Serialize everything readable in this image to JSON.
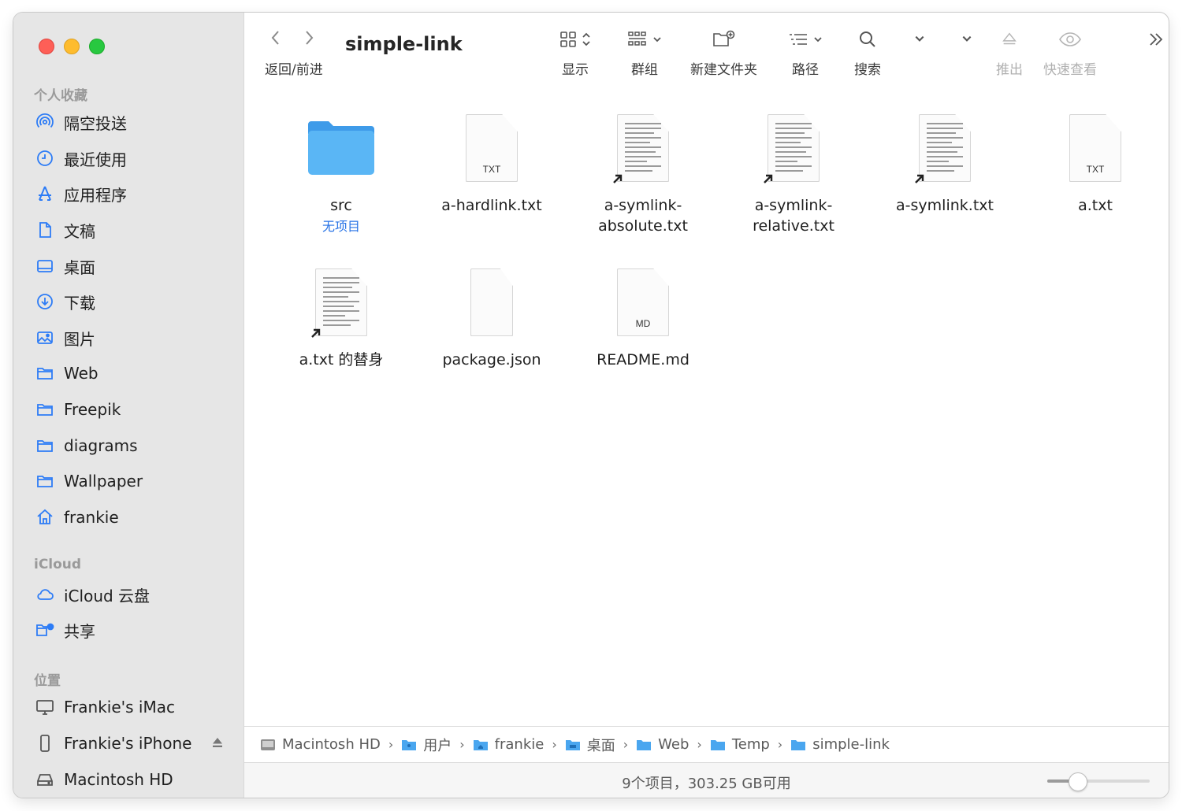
{
  "window": {
    "title": "simple-link"
  },
  "toolbar": {
    "nav_label": "返回/前进",
    "display_label": "显示",
    "group_label": "群组",
    "new_folder_label": "新建文件夹",
    "path_label": "路径",
    "search_label": "搜索",
    "eject_label": "推出",
    "quicklook_label": "快速查看"
  },
  "sidebar": {
    "favorites_title": "个人收藏",
    "favorites": [
      {
        "label": "隔空投送",
        "icon": "airdrop-icon"
      },
      {
        "label": "最近使用",
        "icon": "clock-icon"
      },
      {
        "label": "应用程序",
        "icon": "applications-icon"
      },
      {
        "label": "文稿",
        "icon": "document-icon"
      },
      {
        "label": "桌面",
        "icon": "desktop-icon"
      },
      {
        "label": "下载",
        "icon": "download-icon"
      },
      {
        "label": "图片",
        "icon": "photo-icon"
      },
      {
        "label": "Web",
        "icon": "folder-icon"
      },
      {
        "label": "Freepik",
        "icon": "folder-icon"
      },
      {
        "label": "diagrams",
        "icon": "folder-icon"
      },
      {
        "label": "Wallpaper",
        "icon": "folder-icon"
      },
      {
        "label": "frankie",
        "icon": "home-icon"
      }
    ],
    "icloud_title": "iCloud",
    "icloud": [
      {
        "label": "iCloud 云盘",
        "icon": "cloud-icon"
      },
      {
        "label": "共享",
        "icon": "shared-folder-icon"
      }
    ],
    "locations_title": "位置",
    "locations": [
      {
        "label": "Frankie's iMac",
        "icon": "imac-icon"
      },
      {
        "label": "Frankie's iPhone",
        "icon": "iphone-icon"
      },
      {
        "label": "Macintosh HD",
        "icon": "disk-icon"
      }
    ]
  },
  "files": [
    {
      "name": "src",
      "sub": "无项目",
      "kind": "folder"
    },
    {
      "name": "a-hardlink.txt",
      "kind": "txt",
      "tag": "TXT"
    },
    {
      "name": "a-symlink-\nabsolute.txt",
      "kind": "alias"
    },
    {
      "name": "a-symlink-\nrelative.txt",
      "kind": "alias"
    },
    {
      "name": "a-symlink.txt",
      "kind": "alias"
    },
    {
      "name": "a.txt",
      "kind": "txt",
      "tag": "TXT"
    },
    {
      "name": "a.txt 的替身",
      "kind": "alias"
    },
    {
      "name": "package.json",
      "kind": "blank"
    },
    {
      "name": "README.md",
      "kind": "txt",
      "tag": "MD"
    }
  ],
  "pathbar": [
    {
      "label": "Macintosh HD",
      "icon": "disk-icon"
    },
    {
      "label": "用户",
      "icon": "users-folder-icon"
    },
    {
      "label": "frankie",
      "icon": "home-folder-icon"
    },
    {
      "label": "桌面",
      "icon": "desktop-folder-icon"
    },
    {
      "label": "Web",
      "icon": "folder-icon"
    },
    {
      "label": "Temp",
      "icon": "folder-icon"
    },
    {
      "label": "simple-link",
      "icon": "folder-icon"
    }
  ],
  "status": {
    "text": "9个项目，303.25 GB可用",
    "zoom_level": 0.25
  },
  "colors": {
    "accent": "#2672e6",
    "folder": "#5ab6f5",
    "sidebar_icon": "#2d7cf6"
  }
}
